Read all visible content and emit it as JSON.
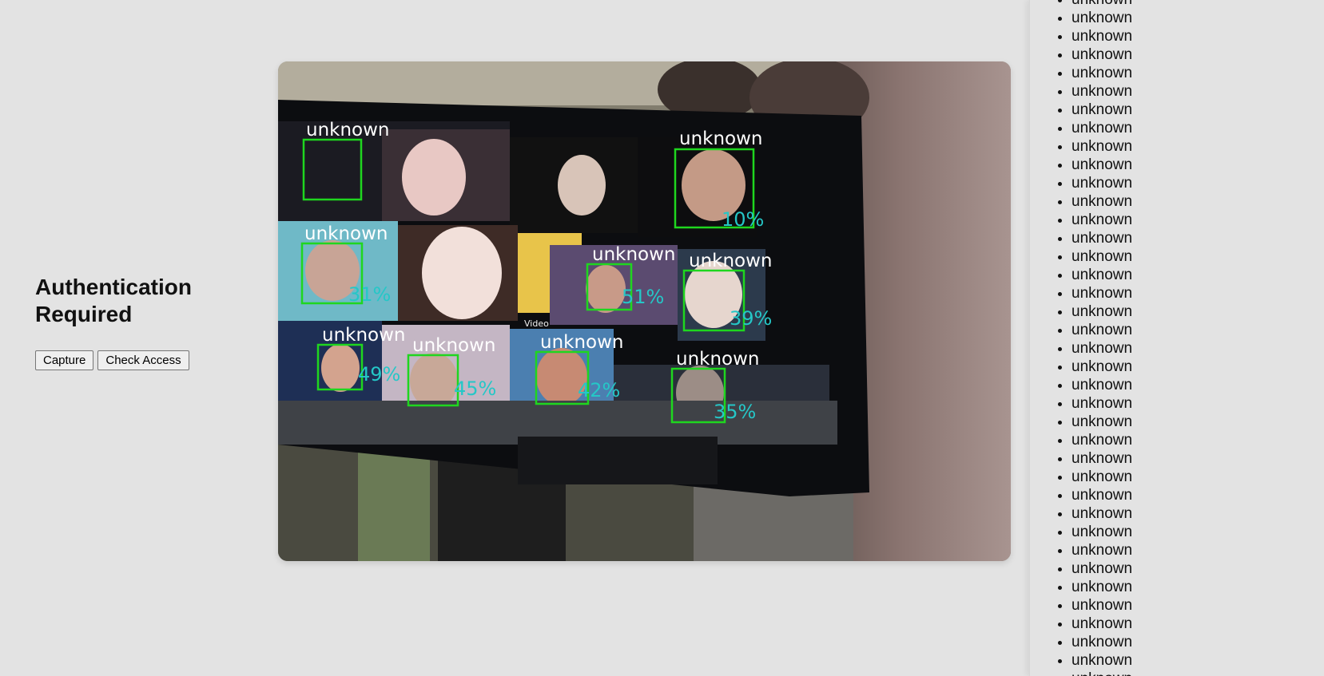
{
  "auth": {
    "title": "Authentication Required",
    "capture_label": "Capture",
    "check_label": "Check Access"
  },
  "video": {
    "overlay_text": "Video",
    "detections": [
      {
        "label": "unknown",
        "confidence": ""
      },
      {
        "label": "unknown",
        "confidence": "10%"
      },
      {
        "label": "unknown",
        "confidence": "31%"
      },
      {
        "label": "unknown",
        "confidence": "51%"
      },
      {
        "label": "unknown",
        "confidence": "39%"
      },
      {
        "label": "unknown",
        "confidence": "49%"
      },
      {
        "label": "unknown",
        "confidence": "45%"
      },
      {
        "label": "unknown",
        "confidence": "42%"
      },
      {
        "label": "unknown",
        "confidence": "35%"
      }
    ],
    "box_color": "#1fd61f",
    "pct_color": "#25c7c7"
  },
  "results": {
    "items": [
      "unknown",
      "unknown",
      "unknown",
      "unknown",
      "unknown",
      "unknown",
      "unknown",
      "unknown",
      "unknown",
      "unknown",
      "unknown",
      "unknown",
      "unknown",
      "unknown",
      "unknown",
      "unknown",
      "unknown",
      "unknown",
      "unknown",
      "unknown",
      "unknown",
      "unknown",
      "unknown",
      "unknown",
      "unknown",
      "unknown",
      "unknown",
      "unknown",
      "unknown",
      "unknown",
      "unknown",
      "unknown",
      "unknown",
      "unknown",
      "unknown",
      "unknown",
      "unknown",
      "unknown"
    ]
  }
}
